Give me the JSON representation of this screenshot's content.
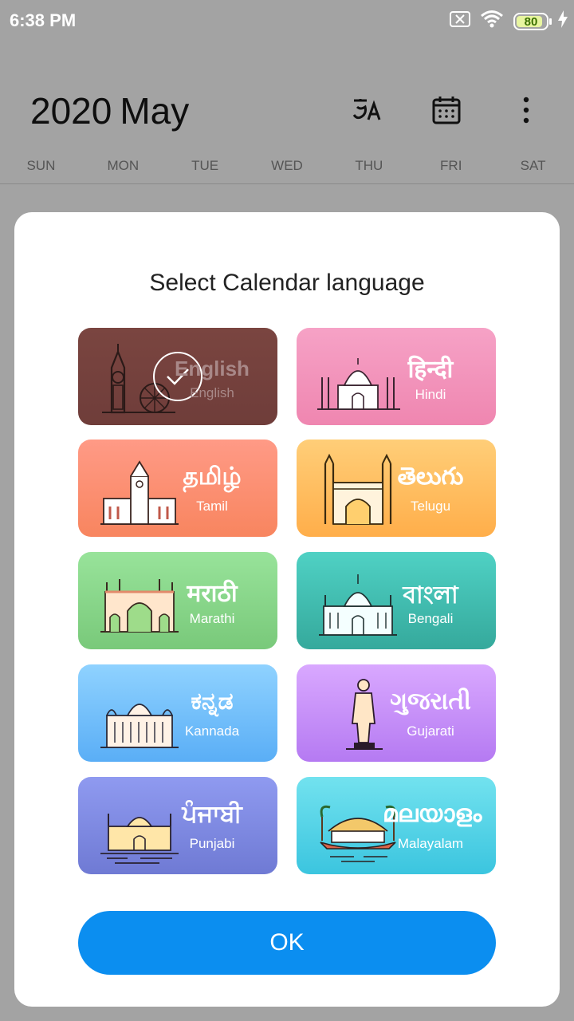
{
  "status_bar": {
    "time": "6:38 PM",
    "battery": "80"
  },
  "calendar": {
    "year": "2020",
    "month": "May",
    "weekdays": [
      "SUN",
      "MON",
      "TUE",
      "WED",
      "THU",
      "FRI",
      "SAT"
    ]
  },
  "icons": {
    "translate": "translate-icon",
    "calendar": "calendar-icon",
    "more": "more-vertical-icon",
    "check": "check-icon"
  },
  "dialog": {
    "title": "Select Calendar language",
    "ok_label": "OK",
    "selected_language": "English",
    "languages": [
      {
        "native": "English",
        "name": "English",
        "colors": [
          "#7a4540",
          "#6f3d3a"
        ]
      },
      {
        "native": "हिन्दी",
        "name": "Hindi",
        "colors": [
          "#f6a2c6",
          "#ef86b0"
        ]
      },
      {
        "native": "தமிழ்",
        "name": "Tamil",
        "colors": [
          "#ff9a86",
          "#f8855f"
        ]
      },
      {
        "native": "తెలుగు",
        "name": "Telugu",
        "colors": [
          "#ffce78",
          "#ffae4a"
        ]
      },
      {
        "native": "मराठी",
        "name": "Marathi",
        "colors": [
          "#98e39a",
          "#79c97a"
        ]
      },
      {
        "native": "বাংলা",
        "name": "Bengali",
        "colors": [
          "#4fd1c4",
          "#35a99c"
        ]
      },
      {
        "native": "ಕನ್ನಡ",
        "name": "Kannada",
        "colors": [
          "#8fd2ff",
          "#5aaef6"
        ]
      },
      {
        "native": "ગુજરાતી",
        "name": "Gujarati",
        "colors": [
          "#d9a8ff",
          "#b57af2"
        ]
      },
      {
        "native": "ਪੰਜਾਬੀ",
        "name": "Punjabi",
        "colors": [
          "#8f9af0",
          "#6f7ad4"
        ]
      },
      {
        "native": "മലയാളം",
        "name": "Malayalam",
        "colors": [
          "#72e2ef",
          "#3bc5df"
        ]
      }
    ]
  }
}
